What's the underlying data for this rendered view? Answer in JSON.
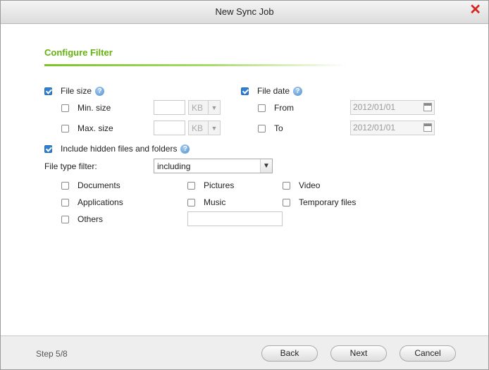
{
  "window": {
    "title": "New Sync Job",
    "close_glyph": "✕"
  },
  "section": {
    "title": "Configure Filter"
  },
  "file_size": {
    "label": "File size",
    "checked": true,
    "min_label": "Min. size",
    "max_label": "Max. size",
    "min_value": "",
    "max_value": "",
    "min_unit": "KB",
    "max_unit": "KB"
  },
  "file_date": {
    "label": "File date",
    "checked": true,
    "from_label": "From",
    "to_label": "To",
    "from_value": "2012/01/01",
    "to_value": "2012/01/01"
  },
  "hidden": {
    "label": "Include hidden files and folders",
    "checked": true
  },
  "file_type": {
    "label": "File type filter:",
    "selected": "including",
    "options": {
      "documents": "Documents",
      "pictures": "Pictures",
      "video": "Video",
      "applications": "Applications",
      "music": "Music",
      "temporary": "Temporary files",
      "others": "Others"
    },
    "others_value": ""
  },
  "footer": {
    "step": "Step 5/8",
    "back": "Back",
    "next": "Next",
    "cancel": "Cancel"
  },
  "icons": {
    "help": "help-icon",
    "close": "close-icon",
    "calendar": "calendar-icon",
    "dropdown": "chevron-down-icon"
  },
  "colors": {
    "accent_green": "#64b20f",
    "checkbox_blue": "#2f7fd2",
    "close_red": "#d8231e"
  }
}
